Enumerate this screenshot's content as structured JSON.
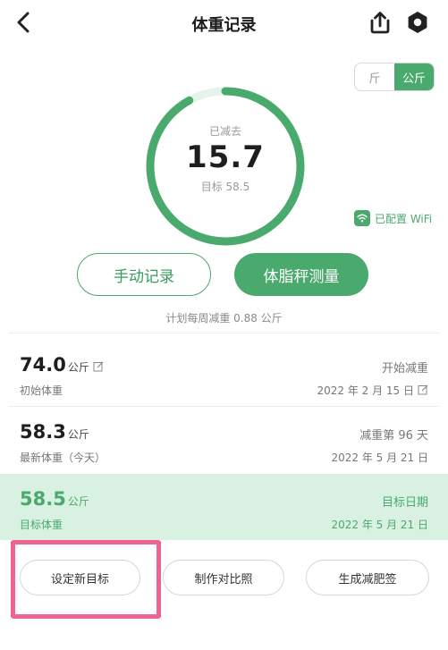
{
  "header": {
    "title": "体重记录"
  },
  "unit_toggle": {
    "options": [
      "斤",
      "公斤"
    ],
    "selected": "公斤"
  },
  "summary": {
    "lost_label": "已减去",
    "lost_value": "15.7",
    "goal_label": "目标 58.5",
    "progress": 0.92,
    "wifi_status": "已配置 WiFi"
  },
  "actions": {
    "manual_record": "手动记录",
    "scale_measure": "体脂秤测量"
  },
  "plan_text": "计划每周减重 0.88 公斤",
  "rows": [
    {
      "value": "74.0",
      "unit": "公斤",
      "label": "初始体重",
      "right_top": "开始减重",
      "right_bottom": "2022 年 2 月 15 日"
    },
    {
      "value": "58.3",
      "unit": "公斤",
      "label": "最新体重（今天）",
      "right_top": "减重第 96 天",
      "right_bottom": "2022 年 5 月 21 日"
    },
    {
      "value": "58.5",
      "unit": "公斤",
      "label": "目标体重",
      "right_top": "目标日期",
      "right_bottom": "2022 年 5 月 21 日"
    }
  ],
  "bottom_buttons": [
    "设定新目标",
    "制作对比照",
    "生成减肥签"
  ],
  "colors": {
    "accent": "#4aa96c",
    "highlight": "#f06292",
    "row_highlight": "#d9f1e3"
  }
}
